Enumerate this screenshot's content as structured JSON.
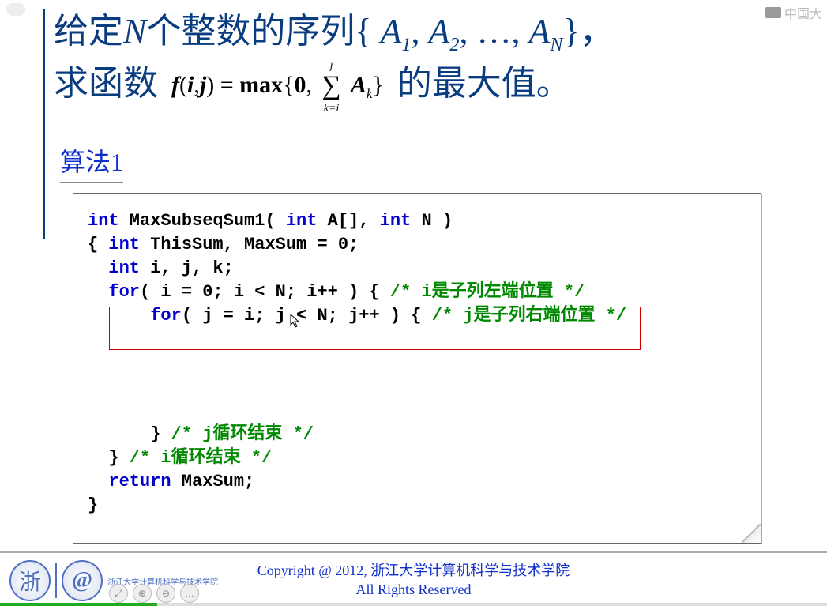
{
  "watermark": "中国大",
  "title": {
    "pre": "给定",
    "N": "N",
    "mid1": "个整数的序列{ ",
    "seq": {
      "A": "A",
      "sep": ", ",
      "dots": "…",
      "close": "}"
    },
    "comma": "，",
    "line2_pre": "求函数",
    "formula": {
      "f": "f",
      "open": "(",
      "i": "i",
      "comma": ",",
      "j": "j",
      "close": ")",
      "eq": "=",
      "max": "max",
      "fopen": "{",
      "zero": "0",
      "c2": ",",
      "sigma": {
        "sym": "∑",
        "top": "j",
        "bot": "k=i"
      },
      "A": "A",
      "sub": "k",
      "fclose": "}"
    },
    "suffix": " 的最大值。"
  },
  "section": "算法1",
  "code": [
    {
      "t": "int",
      "c": "kw"
    },
    {
      "t": " MaxSubseqSum1( "
    },
    {
      "t": "int",
      "c": "kw"
    },
    {
      "t": " A[], "
    },
    {
      "t": "int",
      "c": "kw"
    },
    {
      "t": " N )"
    },
    {
      "nl": 1
    },
    {
      "t": "{ "
    },
    {
      "t": "int",
      "c": "kw"
    },
    {
      "t": " ThisSum, MaxSum = 0;"
    },
    {
      "nl": 1
    },
    {
      "t": "  "
    },
    {
      "t": "int",
      "c": "kw"
    },
    {
      "t": " i, j, k;"
    },
    {
      "nl": 1
    },
    {
      "t": "  "
    },
    {
      "t": "for",
      "c": "kw"
    },
    {
      "t": "( i = 0; i < N; i++ ) { "
    },
    {
      "t": "/* i是子列左端位置 */",
      "c": "cm"
    },
    {
      "nl": 1
    },
    {
      "t": "      "
    },
    {
      "t": "for",
      "c": "kw"
    },
    {
      "t": "( j = i; j < N; j++ ) { "
    },
    {
      "t": "/* j是子列右端位置 */",
      "c": "cm"
    },
    {
      "nl": 1
    },
    {
      "nl": 1
    },
    {
      "nl": 1
    },
    {
      "nl": 1
    },
    {
      "nl": 1
    },
    {
      "t": "      } "
    },
    {
      "t": "/* j循环结束 */",
      "c": "cm"
    },
    {
      "nl": 1
    },
    {
      "t": "  } "
    },
    {
      "t": "/* i循环结束 */",
      "c": "cm"
    },
    {
      "nl": 1
    },
    {
      "t": "  "
    },
    {
      "t": "return",
      "c": "kw"
    },
    {
      "t": " MaxSum;"
    },
    {
      "nl": 1
    },
    {
      "t": "}"
    }
  ],
  "copyright": {
    "line1": "Copyright @ 2012, 浙江大学计算机科学与技术学院",
    "line2": "All Rights Reserved"
  },
  "logos": {
    "badge": "浙",
    "at": "@",
    "sub": "浙江大学计算机科学与技术学院"
  },
  "controls": [
    "⤢",
    "⊕",
    "⊖",
    "…"
  ],
  "progress_pct": 19
}
